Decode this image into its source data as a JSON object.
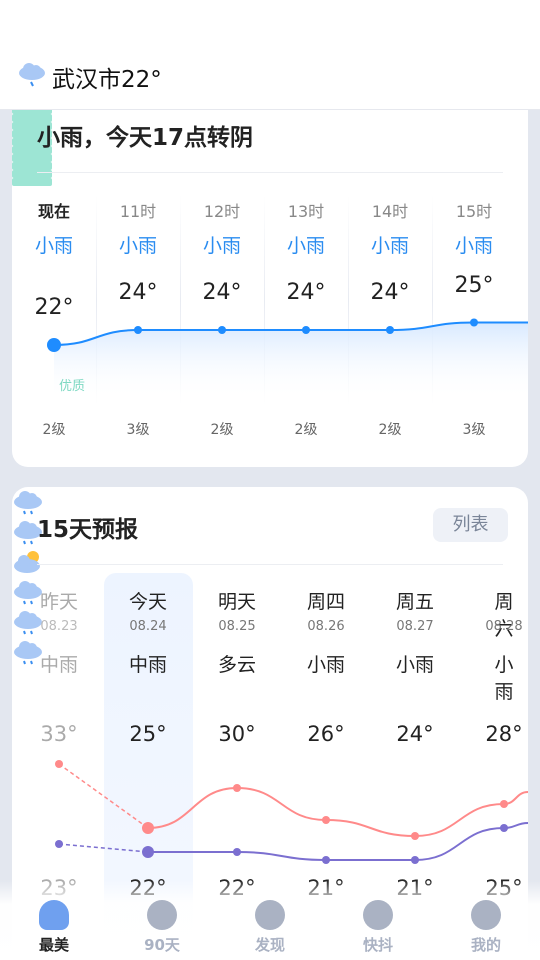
{
  "header": {
    "city_temp": "武汉市22°",
    "icon": "light-rain-cloud-icon"
  },
  "hourly": {
    "summary": "小雨，今天17点转阴",
    "aqi_label": "优质",
    "items": [
      {
        "time": "现在",
        "weather": "小雨",
        "temp": 22,
        "temp_label": "22°",
        "wind": "2级"
      },
      {
        "time": "11时",
        "weather": "小雨",
        "temp": 24,
        "temp_label": "24°",
        "wind": "3级"
      },
      {
        "time": "12时",
        "weather": "小雨",
        "temp": 24,
        "temp_label": "24°",
        "wind": "2级"
      },
      {
        "time": "13时",
        "weather": "小雨",
        "temp": 24,
        "temp_label": "24°",
        "wind": "2级"
      },
      {
        "time": "14时",
        "weather": "小雨",
        "temp": 24,
        "temp_label": "24°",
        "wind": "2级"
      },
      {
        "time": "15时",
        "weather": "小雨",
        "temp": 25,
        "temp_label": "25°",
        "wind": "3级"
      }
    ]
  },
  "forecast": {
    "title": "15天预报",
    "list_button": "列表",
    "days": [
      {
        "day": "昨天",
        "date": "08.23",
        "weather": "中雨",
        "icon": "rain-cloud-icon",
        "high": 33,
        "high_label": "33°",
        "low": 23,
        "low_label": "23°"
      },
      {
        "day": "今天",
        "date": "08.24",
        "weather": "中雨",
        "icon": "rain-cloud-icon",
        "high": 25,
        "high_label": "25°",
        "low": 22,
        "low_label": "22°"
      },
      {
        "day": "明天",
        "date": "08.25",
        "weather": "多云",
        "icon": "partly-cloudy-icon",
        "high": 30,
        "high_label": "30°",
        "low": 22,
        "low_label": "22°"
      },
      {
        "day": "周四",
        "date": "08.26",
        "weather": "小雨",
        "icon": "rain-cloud-icon",
        "high": 26,
        "high_label": "26°",
        "low": 21,
        "low_label": "21°"
      },
      {
        "day": "周五",
        "date": "08.27",
        "weather": "小雨",
        "icon": "rain-cloud-icon",
        "high": 24,
        "high_label": "24°",
        "low": 21,
        "low_label": "21°"
      },
      {
        "day": "周六",
        "date": "08.28",
        "weather": "小雨",
        "icon": "rain-cloud-icon",
        "high": 28,
        "high_label": "28°",
        "low": 25,
        "low_label": "25°"
      }
    ]
  },
  "nav": [
    {
      "label": "最美",
      "active": true
    },
    {
      "label": "90天"
    },
    {
      "label": "发现"
    },
    {
      "label": "快抖"
    },
    {
      "label": "我的"
    }
  ],
  "colors": {
    "accent": "#1e8cff",
    "high": "#ff8a8a",
    "low": "#7b6fd0",
    "aqi": "#9de5d4"
  }
}
